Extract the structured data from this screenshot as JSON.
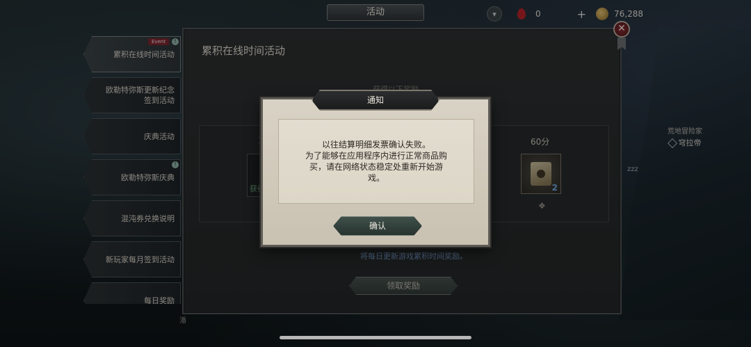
{
  "top_bar": {
    "tab_label": "活动",
    "gem_count": "0",
    "coin_count": "76,288"
  },
  "npc": {
    "title": "荒地冒险家",
    "name": "穹拉帝",
    "status": "zzz"
  },
  "sidebar": {
    "items": [
      {
        "label": "累积在线时间活动",
        "badge": "Event",
        "info": "!"
      },
      {
        "label": "欧勒特弥斯更新纪念\n签到活动"
      },
      {
        "label": "庆典活动"
      },
      {
        "label": "欧勒特弥斯庆典",
        "info": "!"
      },
      {
        "label": "混沌券兑换说明"
      },
      {
        "label": "新玩家每月签到活动"
      },
      {
        "label": "每日奖励"
      }
    ]
  },
  "panel": {
    "title": "累积在线时间活动",
    "reward_header": "获得以下奖励",
    "left_number": "1",
    "left_slot_text": "获得",
    "right_points": "60分",
    "item_count": "2",
    "footer_note": "将每日更新游戏累积时间奖励。",
    "claim_label": "领取奖励",
    "bottom_glyph": "潘"
  },
  "dialog": {
    "title": "通知",
    "message": "以往结算明细发票确认失败。\n为了能够在应用程序内进行正常商品购\n买，请在网络状态稳定处重新开始游\n戏。",
    "confirm_label": "确认"
  },
  "icons": {
    "close": "close-icon",
    "download": "download-icon",
    "gem": "red-gem-icon",
    "coin": "gold-coin-icon"
  }
}
